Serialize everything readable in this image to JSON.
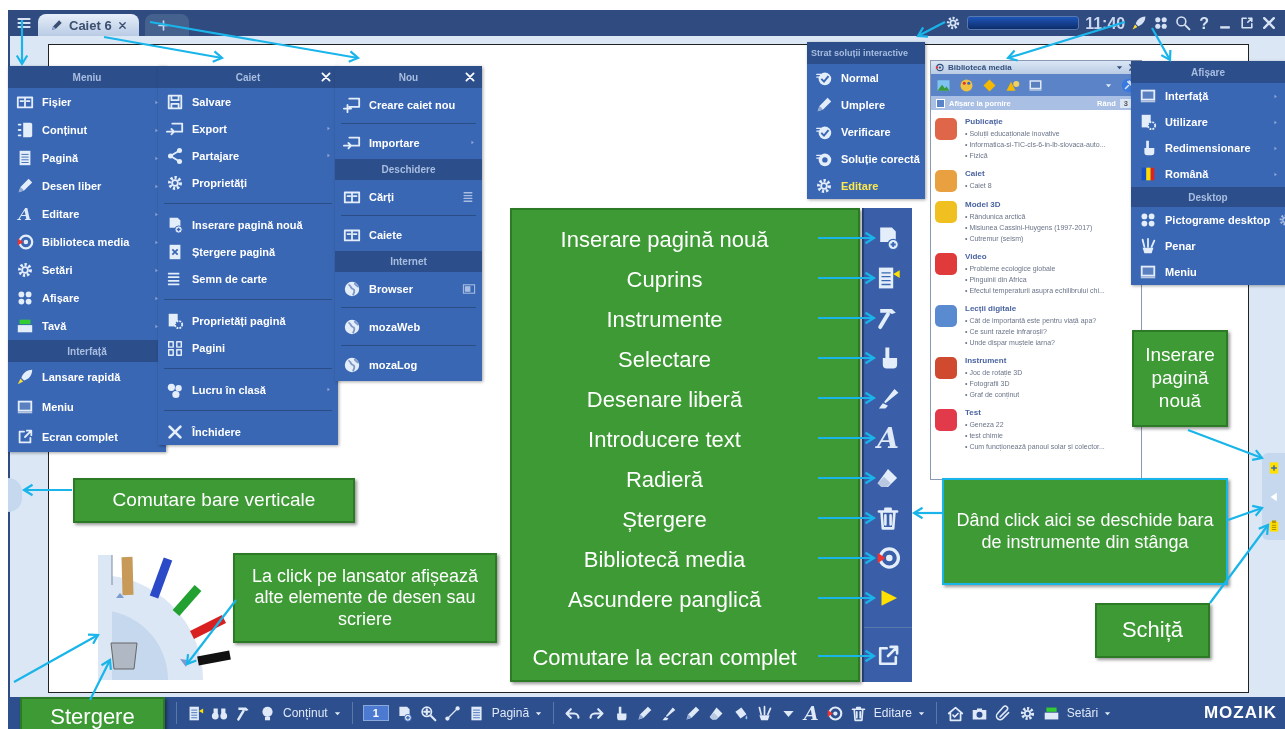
{
  "title_bar": {
    "tabs": [
      {
        "label": "Caiet 6",
        "selected": true
      }
    ],
    "clock": "11:40",
    "help": "?"
  },
  "menus": [
    {
      "title": "Meniu",
      "closable": false,
      "entries": [
        {
          "kind": "item",
          "label": "Fișier",
          "submenu": true
        },
        {
          "kind": "item",
          "label": "Conținut",
          "submenu": true
        },
        {
          "kind": "item",
          "label": "Pagină",
          "submenu": true
        },
        {
          "kind": "item",
          "label": "Desen liber",
          "submenu": true
        },
        {
          "kind": "item",
          "label": "Editare",
          "submenu": true,
          "glyph": "A"
        },
        {
          "kind": "item",
          "label": "Biblioteca media",
          "submenu": true
        },
        {
          "kind": "item",
          "label": "Setări",
          "submenu": true
        },
        {
          "kind": "item",
          "label": "Afișare",
          "submenu": true
        },
        {
          "kind": "item",
          "label": "Tavă",
          "submenu": true
        },
        {
          "kind": "header",
          "label": "Interfață"
        },
        {
          "kind": "item",
          "label": "Lansare rapidă",
          "submenu": false
        },
        {
          "kind": "item",
          "label": "Meniu",
          "submenu": false
        },
        {
          "kind": "item",
          "label": "Ecran complet",
          "submenu": false
        }
      ]
    },
    {
      "title": "Caiet",
      "closable": true,
      "entries": [
        {
          "kind": "item",
          "label": "Salvare",
          "submenu": false
        },
        {
          "kind": "item",
          "label": "Export",
          "submenu": true
        },
        {
          "kind": "item",
          "label": "Partajare",
          "submenu": true
        },
        {
          "kind": "item",
          "label": "Proprietăți",
          "submenu": false
        },
        {
          "kind": "divider"
        },
        {
          "kind": "item",
          "label": "Inserare pagină nouă",
          "submenu": false
        },
        {
          "kind": "item",
          "label": "Ștergere pagină",
          "submenu": false
        },
        {
          "kind": "item",
          "label": "Semn de carte",
          "submenu": false
        },
        {
          "kind": "divider"
        },
        {
          "kind": "item",
          "label": "Proprietăți pagină",
          "submenu": false
        },
        {
          "kind": "item",
          "label": "Pagini",
          "submenu": false
        },
        {
          "kind": "divider"
        },
        {
          "kind": "item",
          "label": "Lucru în clasă",
          "submenu": true
        },
        {
          "kind": "divider"
        },
        {
          "kind": "item",
          "label": "Închidere",
          "submenu": false
        }
      ]
    },
    {
      "title": "Nou",
      "closable": true,
      "entries": [
        {
          "kind": "item",
          "label": "Creare caiet nou",
          "submenu": false
        },
        {
          "kind": "divider"
        },
        {
          "kind": "item",
          "label": "Importare",
          "submenu": true
        },
        {
          "kind": "header",
          "label": "Deschidere"
        },
        {
          "kind": "item",
          "label": "Cărți",
          "submenu": false
        },
        {
          "kind": "divider"
        },
        {
          "kind": "item",
          "label": "Caiete",
          "submenu": false
        },
        {
          "kind": "header",
          "label": "Internet"
        },
        {
          "kind": "item",
          "label": "Browser",
          "submenu": false
        },
        {
          "kind": "divider"
        },
        {
          "kind": "item",
          "label": "mozaWeb",
          "submenu": false
        },
        {
          "kind": "divider"
        },
        {
          "kind": "item",
          "label": "mozaLog",
          "submenu": false
        }
      ]
    },
    {
      "title": "Strat soluții interactive",
      "closable": false,
      "entries": [
        {
          "kind": "item",
          "label": "Normal",
          "selected": false
        },
        {
          "kind": "item",
          "label": "Umplere",
          "selected": false
        },
        {
          "kind": "item",
          "label": "Verificare",
          "selected": false
        },
        {
          "kind": "item",
          "label": "Soluție corectă",
          "selected": false
        },
        {
          "kind": "item",
          "label": "Editare",
          "selected": true
        }
      ]
    },
    {
      "title": "Afișare",
      "closable": false,
      "entries": [
        {
          "kind": "item",
          "label": "Interfață",
          "submenu": true
        },
        {
          "kind": "item",
          "label": "Utilizare",
          "submenu": true
        },
        {
          "kind": "item",
          "label": "Redimensionare",
          "submenu": true
        },
        {
          "kind": "item",
          "label": "Română",
          "submenu": true
        },
        {
          "kind": "header",
          "label": "Desktop"
        },
        {
          "kind": "item",
          "label": "Pictograme desktop",
          "submenu": false
        },
        {
          "kind": "item",
          "label": "Penar",
          "submenu": false
        },
        {
          "kind": "item",
          "label": "Meniu",
          "submenu": false
        }
      ]
    }
  ],
  "media_library": {
    "title": "Bibliotecă media",
    "show_on_start": {
      "label": "Afișare la pornire",
      "checked": false
    },
    "rows": {
      "label": "Rând",
      "value": "3"
    },
    "categories": [
      {
        "title": "Publicație",
        "color": "#e0664a",
        "items": [
          "• Soluții educaționale inovative",
          "• Informatica-si-TIC-cls-6-in-lb-slovaca-auto...",
          "• Fizică"
        ]
      },
      {
        "title": "Caiet",
        "color": "#e8a040",
        "items": [
          "• Caiet 8"
        ]
      },
      {
        "title": "Model 3D",
        "color": "#f0c020",
        "items": [
          "• Rândunica arctică",
          "• Misiunea Cassini-Huygens (1997-2017)",
          "• Cutremur (seism)"
        ]
      },
      {
        "title": "Video",
        "color": "#e03a3a",
        "items": [
          "• Probleme ecologice globale",
          "• Pinguinii din Africa",
          "• Efectul temperaturii asupra echilibrului chi..."
        ]
      },
      {
        "title": "Lecții digitale",
        "color": "#5a8ad0",
        "items": [
          "• Cât de importantă este pentru viață apa?",
          "• Ce sunt razele infraroșii?",
          "• Unde dispar muștele iarna?"
        ]
      },
      {
        "title": "Instrument",
        "color": "#d04a30",
        "items": [
          "• Joc de rotație 3D",
          "• Fotografii 3D",
          "• Graf de conținut"
        ]
      },
      {
        "title": "Test",
        "color": "#e23a4a",
        "items": [
          "• Geneza 22",
          "• test chimie",
          "• Cum funcționează panoul solar și colector..."
        ]
      }
    ]
  },
  "toolbar_callout": {
    "labels": [
      "Inserare pagină nouă",
      "Cuprins",
      "Instrumente",
      "Selectare",
      "Desenare liberă",
      "Introducere text",
      "Radieră",
      "Ștergere",
      "Bibliotecă media",
      "Ascundere panglică",
      "Comutare la ecran complet"
    ]
  },
  "vertical_toolbar": {
    "text_tool": "A"
  },
  "callouts": [
    "Comutare bare verticale",
    "La click pe lansator afișează alte elemente de desen sau scriere",
    "Stergere",
    "Inserare pagină nouă",
    "Dând click aici se deschide bara de instrumente din stânga",
    "Schiță"
  ],
  "bottom_toolbar": {
    "sections": [
      {
        "menu": "Conținut"
      },
      {
        "page_field": "1",
        "menu": "Pagină"
      },
      {
        "glyph": "A",
        "menu": "Editare"
      },
      {
        "menu": "Setări"
      }
    ],
    "logo": "MOZAIK"
  }
}
